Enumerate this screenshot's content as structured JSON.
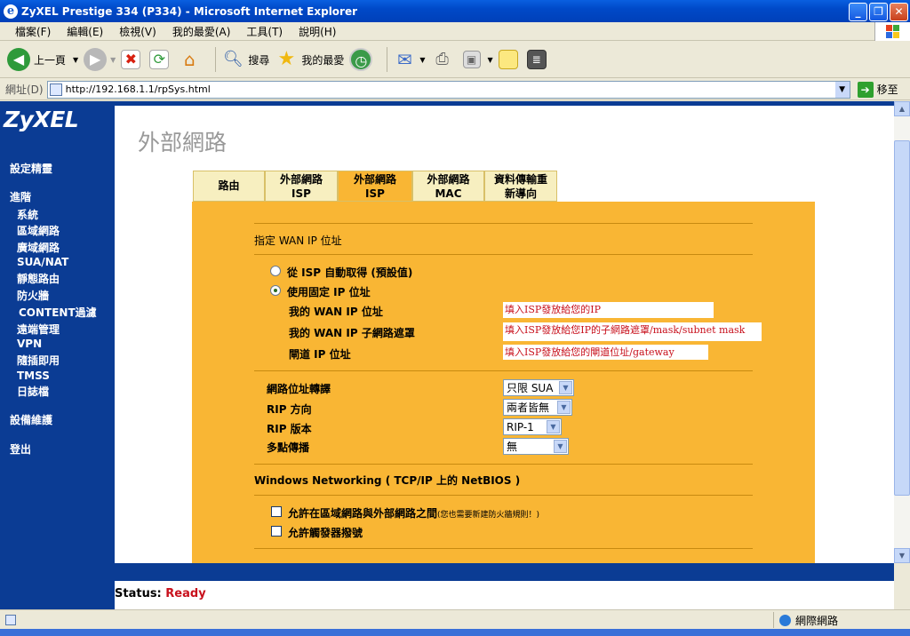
{
  "window": {
    "title": "ZyXEL Prestige 334 (P334) - Microsoft Internet Explorer"
  },
  "menu": [
    "檔案(F)",
    "編輯(E)",
    "檢視(V)",
    "我的最愛(A)",
    "工具(T)",
    "說明(H)"
  ],
  "toolbar": {
    "back": "上一頁",
    "search": "搜尋",
    "favorites": "我的最愛"
  },
  "address": {
    "label": "網址(D)",
    "url": "http://192.168.1.1/rpSys.html",
    "go": "移至"
  },
  "sidebar": {
    "logo": "ZyXEL",
    "wizard": "設定精靈",
    "advanced": "進階",
    "items": [
      "系統",
      "區域網路",
      "廣域網路",
      "SUA/NAT",
      "靜態路由",
      "防火牆",
      "CONTENT過濾",
      "遠端管理",
      "VPN",
      "隨插即用",
      "TMSS",
      "日誌檔"
    ],
    "maintenance": "設備維護",
    "logout": "登出"
  },
  "page": {
    "title": "外部網路"
  },
  "tabs": [
    {
      "line1": "路由",
      "line2": ""
    },
    {
      "line1": "外部網路",
      "line2": "ISP"
    },
    {
      "line1": "外部網路",
      "line2": "ISP"
    },
    {
      "line1": "外部網路",
      "line2": "MAC"
    },
    {
      "line1": "資料傳輸重",
      "line2": "新導向"
    }
  ],
  "form": {
    "wan_ip_heading": "指定 WAN IP 位址",
    "radio_auto": "從 ISP 自動取得 (預設值)",
    "radio_fixed": "使用固定 IP 位址",
    "my_wan_ip_label": "我的 WAN IP 位址",
    "my_wan_ip_value": "填入ISP發放給您的IP",
    "subnet_label": "我的 WAN IP 子網路遮罩",
    "subnet_value": "填入ISP發放給您IP的子網路遮罩/mask/subnet mask",
    "gateway_label": "閘道 IP 位址",
    "gateway_value": "填入ISP發放給您的閘道位址/gateway",
    "nat_label": "網路位址轉譯",
    "nat_value": "只限 SUA",
    "rip_dir_label": "RIP 方向",
    "rip_dir_value": "兩者皆無",
    "rip_ver_label": "RIP 版本",
    "rip_ver_value": "RIP-1",
    "multicast_label": "多點傳播",
    "multicast_value": "無",
    "netbios_heading": "Windows Networking ( TCP/IP 上的 NetBIOS )",
    "allow_lan_wan": "允許在區域網路與外部網路之間",
    "allow_lan_wan_note": "(您也需要新建防火牆規則！)",
    "allow_trigger": "允許觸發器撥號"
  },
  "status": {
    "label": "Status:",
    "value": "Ready",
    "value_color": "#C8101C"
  },
  "statusbar": {
    "zone": "網際網路"
  }
}
